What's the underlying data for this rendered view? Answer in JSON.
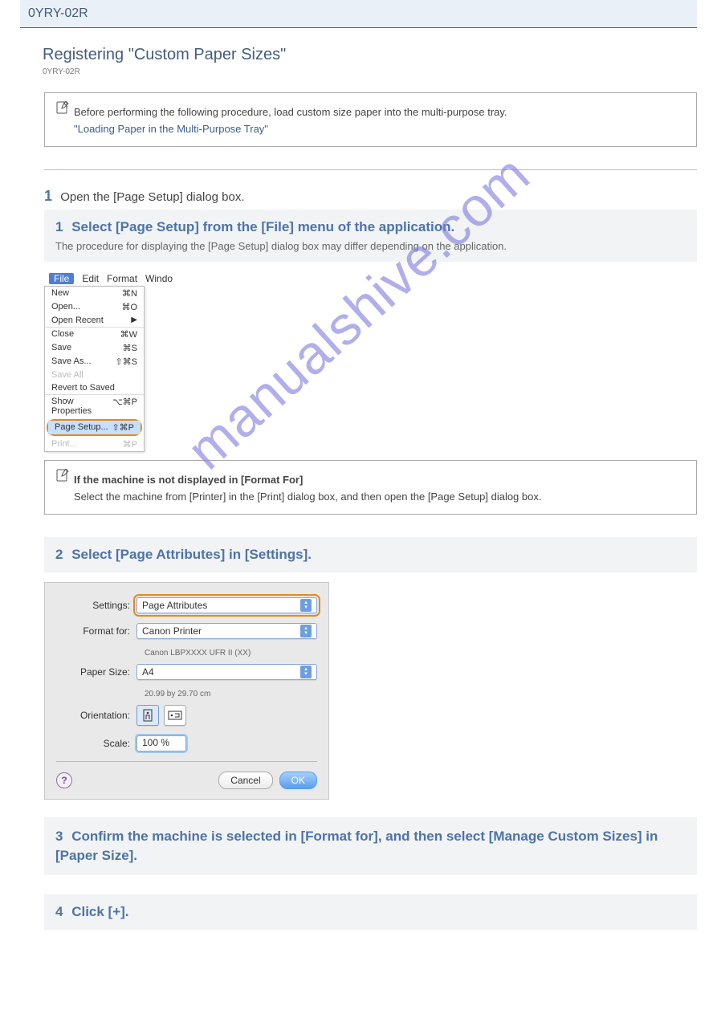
{
  "topbar": "0YRY-02R",
  "title": "Registering \"Custom Paper Sizes\"",
  "refcode": "0YRY-02R",
  "note1": {
    "text": "Before performing the following procedure, load custom size paper into the multi-purpose tray.",
    "link": "\"Loading Paper in the Multi-Purpose Tray\""
  },
  "intro": {
    "num": "1",
    "text": "Open the [Page Setup] dialog box."
  },
  "step1": {
    "num": "1",
    "head": "Select [Page Setup] from the [File] menu of the application.",
    "sub": "The procedure for displaying the [Page Setup] dialog box may differ depending on the application."
  },
  "menubar": {
    "file": "File",
    "edit": "Edit",
    "format": "Format",
    "window": "Windo"
  },
  "filemenu": {
    "new": "New",
    "new_k": "⌘N",
    "open": "Open...",
    "open_k": "⌘O",
    "recent": "Open Recent",
    "close": "Close",
    "close_k": "⌘W",
    "save": "Save",
    "save_k": "⌘S",
    "saveas": "Save As...",
    "saveas_k": "⇧⌘S",
    "saveall": "Save All",
    "revert": "Revert to Saved",
    "props": "Show Properties",
    "props_k": "⌥⌘P",
    "pagesetup": "Page Setup...",
    "pagesetup_k": "⇧⌘P",
    "print": "Print...",
    "print_k": "⌘P"
  },
  "note2": {
    "l1": "If the machine is not displayed in [Format For]",
    "l2": "Select the machine from [Printer] in the [Print] dialog box, and then open the [Page Setup] dialog box."
  },
  "step2": {
    "num": "2",
    "head": "Select [Page Attributes] in [Settings]."
  },
  "dlg": {
    "settings_l": "Settings:",
    "settings_v": "Page Attributes",
    "formatfor_l": "Format for:",
    "formatfor_v": "Canon Printer",
    "formatfor_sub": "Canon LBPXXXX UFR II (XX)",
    "papersize_l": "Paper Size:",
    "papersize_v": "A4",
    "papersize_sub": "20.99 by 29.70 cm",
    "orient_l": "Orientation:",
    "scale_l": "Scale:",
    "scale_v": "100 %",
    "cancel": "Cancel",
    "ok": "OK"
  },
  "step3": {
    "num": "3",
    "head": "Confirm the machine is selected in [Format for], and then select [Manage Custom Sizes] in [Paper Size]."
  },
  "step4": {
    "num": "4",
    "head": "Click [+]."
  },
  "watermark": "manualshive.com"
}
